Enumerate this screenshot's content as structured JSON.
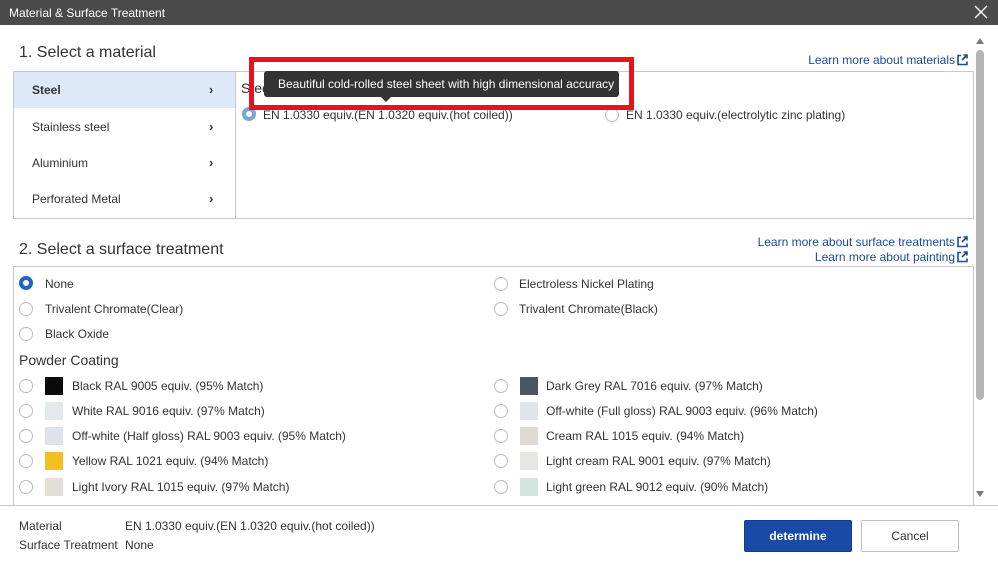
{
  "window": {
    "title": "Material & Surface Treatment"
  },
  "material": {
    "heading": "1. Select a material",
    "learn_more": "Learn more about materials",
    "categories": [
      {
        "label": "Steel",
        "active": true
      },
      {
        "label": "Stainless steel"
      },
      {
        "label": "Aluminium"
      },
      {
        "label": "Perforated Metal"
      }
    ],
    "category_label": "Steel",
    "options": [
      {
        "label": "EN 1.0330 equiv.(EN 1.0320 equiv.(hot coiled))",
        "selected": true
      },
      {
        "label": "EN 1.0330 equiv.(electrolytic zinc plating)",
        "selected": false
      }
    ],
    "tooltip": "Beautiful cold-rolled steel sheet with high dimensional accuracy"
  },
  "surface": {
    "heading": "2. Select a surface treatment",
    "learn_more_treatments": "Learn more about surface treatments",
    "learn_more_painting": "Learn more about painting",
    "basic_options": [
      {
        "label": "None",
        "selected": true
      },
      {
        "label": "Electroless Nickel Plating"
      },
      {
        "label": "Trivalent Chromate(Clear)"
      },
      {
        "label": "Trivalent Chromate(Black)"
      },
      {
        "label": "Black Oxide"
      }
    ],
    "powder_heading": "Powder Coating",
    "powder_options": [
      {
        "label": "Black RAL 9005 equiv. (95% Match)",
        "color": "#0a0a0a"
      },
      {
        "label": "Dark Grey RAL 7016 equiv. (97% Match)",
        "color": "#4b5661"
      },
      {
        "label": "White RAL 9016 equiv. (97% Match)",
        "color": "#e4e9ee"
      },
      {
        "label": "Off-white (Full gloss) RAL 9003 equiv. (96% Match)",
        "color": "#e0e3ec"
      },
      {
        "label": "Off-white (Half gloss) RAL 9003 equiv. (95% Match)",
        "color": "#dde2ec"
      },
      {
        "label": "Cream RAL 1015 equiv. (94% Match)",
        "color": "#dcdad2"
      },
      {
        "label": "Yellow RAL 1021 equiv. (94% Match)",
        "color": "#f0c11f"
      },
      {
        "label": "Light cream RAL 9001 equiv. (97% Match)",
        "color": "#e6e6e2"
      },
      {
        "label": "Light Ivory RAL 1015 equiv. (97% Match)",
        "color": "#e3ded6"
      },
      {
        "label": "Light green RAL 9012 equiv. (90% Match)",
        "color": "#d3e3dd"
      }
    ]
  },
  "summary": {
    "material_key": "Material",
    "material_value": "EN 1.0330 equiv.(EN 1.0320 equiv.(hot coiled))",
    "surface_key": "Surface Treatment",
    "surface_value": "None"
  },
  "buttons": {
    "determine": "determine",
    "cancel": "Cancel"
  },
  "colors": {
    "accent": "#1a4aa8",
    "link": "#1a4a9c",
    "highlight": "#e8121b"
  }
}
